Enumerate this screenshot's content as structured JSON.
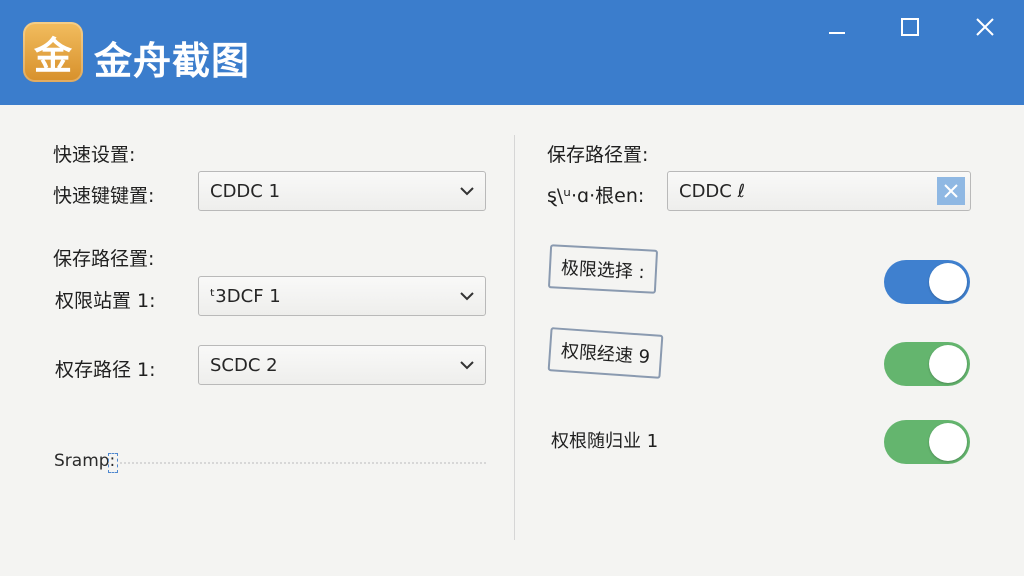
{
  "app": {
    "icon_glyph": "金",
    "title": "金舟截图",
    "brand_color": "#3b7dcc"
  },
  "window_controls": {
    "minimize": "minimize-icon",
    "maximize": "maximize-icon",
    "close": "close-icon"
  },
  "left": {
    "quick_settings": {
      "heading": "快速设置:",
      "shortcut_label": "快速键键置:",
      "shortcut_value": "CDDC 1"
    },
    "save_path": {
      "heading": "保存路径置:",
      "permission_label": "权限站置 1:",
      "permission_value": "ᵗ3DCF 1",
      "path_label": "权存路径 1:",
      "path_value": "SCDC 2"
    },
    "stamp_label": "Sramp:"
  },
  "right": {
    "heading": "保存路径置:",
    "root_label": "ȿ\\ᵘ·ɑ·根en:",
    "root_value": "CDDC ℓ",
    "toggles": [
      {
        "label": "极限选择 :",
        "on": true,
        "color": "#3f80cf"
      },
      {
        "label": "权限经速 9",
        "on": true,
        "color": "#64b56e"
      },
      {
        "label": "权根随归业 1",
        "on": true,
        "color": "#64b56e"
      }
    ]
  }
}
